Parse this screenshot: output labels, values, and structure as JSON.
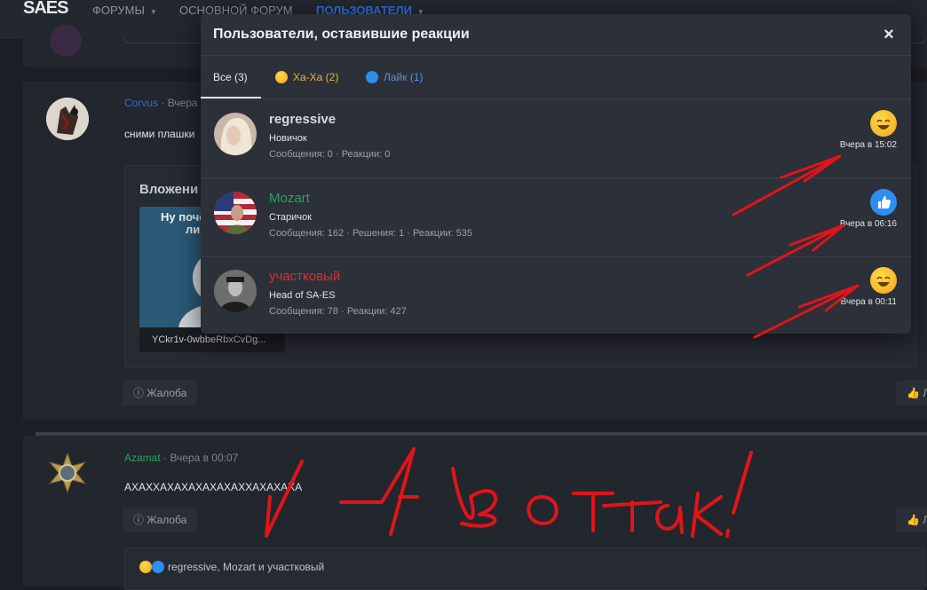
{
  "nav": {
    "logo": "SAES",
    "logo_sub": "",
    "items": [
      "ФОРУМЫ",
      "ОСНОВНОЙ ФОРУМ",
      "ПОЛЬЗОВАТЕЛИ"
    ]
  },
  "post1": {
    "username": "Corvus",
    "time": "Вчера",
    "text": "сними плашки",
    "attachments_title": "Вложени",
    "attachment_caption_top": "Ну поче",
    "attachment_caption_mid": "ли",
    "attachment_name": "YCkr1v-0wbbeRbxCvDg...",
    "report_label": "Жалоба",
    "like_label": "Л"
  },
  "post2": {
    "username": "Azamat",
    "time": "Вчера в 00:07",
    "text": "АХАХХАХАХАХАХАХАХХАХАХАХА",
    "report_label": "Жалоба",
    "like_label": "Л",
    "reactions_summary": "regressive, Mozart и участковый"
  },
  "modal": {
    "title": "Пользователи, оставившие реакции",
    "close_label": "×",
    "tabs": [
      {
        "label": "Все (3)"
      },
      {
        "label": "Ха-Ха (2)"
      },
      {
        "label": "Лайк (1)"
      }
    ],
    "users": [
      {
        "name": "regressive",
        "name_color": "#eef0f3",
        "title": "Новичок",
        "stats": "Сообщения: 0 · Реакции: 0",
        "reaction": "haha-icon",
        "time": "Вчера в 15:02"
      },
      {
        "name": "Mozart",
        "name_color": "#25a55f",
        "title": "Старичок",
        "stats": "Сообщения: 162 · Решения: 1 · Реакции: 535",
        "reaction": "like-icon",
        "time": "Вчера в 06:16"
      },
      {
        "name": "участковый",
        "name_color": "#d3323a",
        "title": "Head of SA-ES",
        "stats": "Сообщения: 78 · Реакции: 427",
        "reaction": "haha-icon",
        "time": "Вчера в 00:11"
      }
    ]
  },
  "annotation": {
    "handwriting": "А вот так!",
    "color": "#e0141a"
  }
}
